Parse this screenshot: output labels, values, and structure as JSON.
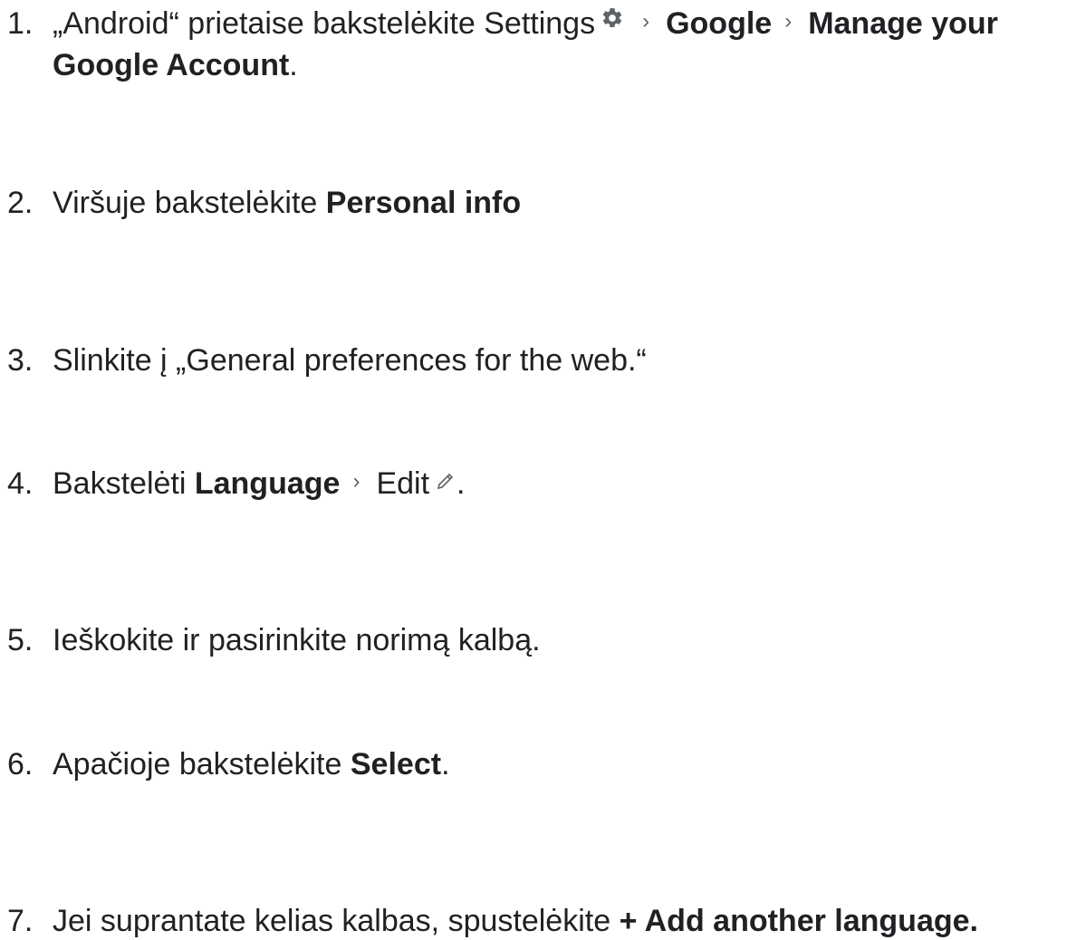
{
  "steps": [
    {
      "num": "1.",
      "prefix": "„Android“ prietaise bakstelėkite Settings",
      "icon": "gear-icon",
      "item1": "Google",
      "item2": "Manage your Google Account",
      "suffix": "."
    },
    {
      "num": "2.",
      "prefix": "Viršuje bakstelėkite",
      "bold": "Personal info"
    },
    {
      "num": "3.",
      "text": "Slinkite į „General preferences for the web.“"
    },
    {
      "num": "4.",
      "prefix": "Bakstelėti",
      "bold": "Language",
      "item2": "Edit",
      "icon": "pencil-icon",
      "suffix": "."
    },
    {
      "num": "5.",
      "text": "Ieškokite ir pasirinkite norimą kalbą."
    },
    {
      "num": "6.",
      "prefix": "Apačioje bakstelėkite",
      "bold": "Select",
      "suffix": "."
    },
    {
      "num": "7.",
      "prefix": "Jei suprantate kelias kalbas, spustelėkite",
      "bold": "+ Add another language."
    }
  ],
  "chevron_icon": "chevron-right-icon",
  "colors": {
    "text": "#202124",
    "icon": "#5f6368",
    "background": "#ffffff"
  }
}
